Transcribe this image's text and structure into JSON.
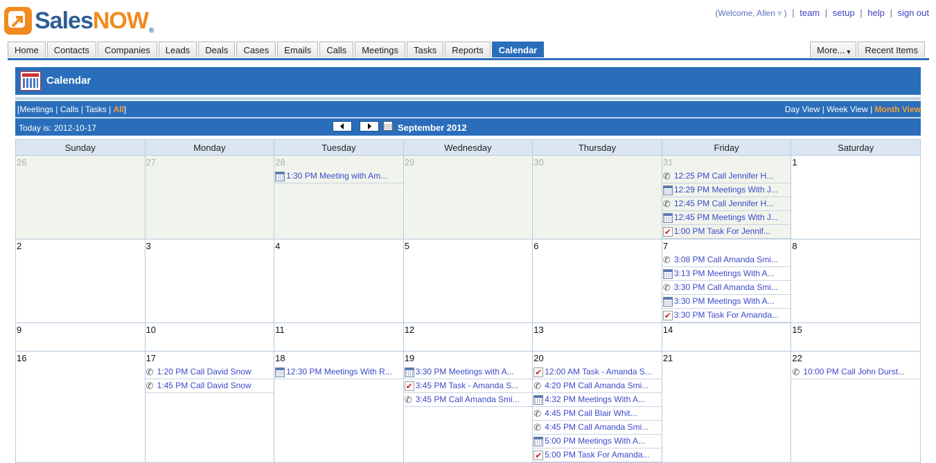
{
  "app": {
    "logo_sales": "Sales",
    "logo_now": "NOW",
    "logo_reg": "®"
  },
  "toplinks": {
    "welcome": "(Welcome, Allen",
    "welcome_close": ")",
    "team": "team",
    "setup": "setup",
    "help": "help",
    "sign_out": "sign out"
  },
  "tabs": [
    "Home",
    "Contacts",
    "Companies",
    "Leads",
    "Deals",
    "Cases",
    "Emails",
    "Calls",
    "Meetings",
    "Tasks",
    "Reports",
    "Calendar"
  ],
  "active_tab": "Calendar",
  "right_tabs": {
    "more": "More...",
    "recent": "Recent Items"
  },
  "page_title": "Calendar",
  "filters": {
    "meetings": "Meetings",
    "calls": "Calls",
    "tasks": "Tasks",
    "all": "All"
  },
  "views": {
    "day": "Day View",
    "week": "Week View",
    "month": "Month View"
  },
  "today_label": "Today is: 2012-10-17",
  "month_label": "September 2012",
  "weekdays": [
    "Sunday",
    "Monday",
    "Tuesday",
    "Wednesday",
    "Thursday",
    "Friday",
    "Saturday"
  ],
  "weeks": [
    [
      {
        "day": "26",
        "other": true,
        "events": []
      },
      {
        "day": "27",
        "other": true,
        "events": []
      },
      {
        "day": "28",
        "other": true,
        "events": [
          {
            "type": "meeting",
            "text": "1:30 PM Meeting with Am..."
          }
        ]
      },
      {
        "day": "29",
        "other": true,
        "events": []
      },
      {
        "day": "30",
        "other": true,
        "events": []
      },
      {
        "day": "31",
        "other": true,
        "events": [
          {
            "type": "call",
            "text": "12:25 PM Call Jennifer H..."
          },
          {
            "type": "meeting",
            "text": "12:29 PM Meetings With J..."
          },
          {
            "type": "call",
            "text": "12:45 PM Call Jennifer H..."
          },
          {
            "type": "meeting",
            "text": "12:45 PM Meetings With J..."
          },
          {
            "type": "task",
            "text": "1:00 PM Task For Jennif..."
          }
        ]
      },
      {
        "day": "1",
        "other": false,
        "events": []
      }
    ],
    [
      {
        "day": "2",
        "events": []
      },
      {
        "day": "3",
        "events": []
      },
      {
        "day": "4",
        "events": []
      },
      {
        "day": "5",
        "events": []
      },
      {
        "day": "6",
        "events": []
      },
      {
        "day": "7",
        "events": [
          {
            "type": "call",
            "text": "3:08 PM Call Amanda Smi..."
          },
          {
            "type": "meeting",
            "text": "3:13 PM Meetings With A..."
          },
          {
            "type": "call",
            "text": "3:30 PM Call Amanda Smi..."
          },
          {
            "type": "meeting",
            "text": "3:30 PM Meetings With A..."
          },
          {
            "type": "task",
            "text": "3:30 PM Task For Amanda..."
          }
        ]
      },
      {
        "day": "8",
        "events": []
      }
    ],
    [
      {
        "day": "9",
        "events": []
      },
      {
        "day": "10",
        "events": []
      },
      {
        "day": "11",
        "events": []
      },
      {
        "day": "12",
        "events": []
      },
      {
        "day": "13",
        "events": []
      },
      {
        "day": "14",
        "events": []
      },
      {
        "day": "15",
        "events": []
      }
    ],
    [
      {
        "day": "16",
        "events": []
      },
      {
        "day": "17",
        "events": [
          {
            "type": "call",
            "text": "1:20 PM Call David Snow"
          },
          {
            "type": "call",
            "text": "1:45 PM Call David Snow"
          }
        ]
      },
      {
        "day": "18",
        "events": [
          {
            "type": "meeting",
            "text": "12:30 PM Meetings With R..."
          }
        ]
      },
      {
        "day": "19",
        "events": [
          {
            "type": "meeting",
            "text": "3:30 PM Meetings with A..."
          },
          {
            "type": "task",
            "text": "3:45 PM Task - Amanda S..."
          },
          {
            "type": "call",
            "text": "3:45 PM Call Amanda Smi..."
          }
        ]
      },
      {
        "day": "20",
        "events": [
          {
            "type": "task",
            "text": "12:00 AM Task - Amanda S..."
          },
          {
            "type": "call",
            "text": "4:20 PM Call Amanda Smi..."
          },
          {
            "type": "meeting",
            "text": "4:32 PM Meetings With A..."
          },
          {
            "type": "call",
            "text": "4:45 PM Call Blair Whit..."
          },
          {
            "type": "call",
            "text": "4:45 PM Call Amanda Smi..."
          },
          {
            "type": "meeting",
            "text": "5:00 PM Meetings With A..."
          },
          {
            "type": "task",
            "text": "5:00 PM Task For Amanda..."
          }
        ]
      },
      {
        "day": "21",
        "events": []
      },
      {
        "day": "22",
        "events": [
          {
            "type": "call",
            "text": "10:00 PM Call John Durst..."
          }
        ]
      }
    ]
  ]
}
